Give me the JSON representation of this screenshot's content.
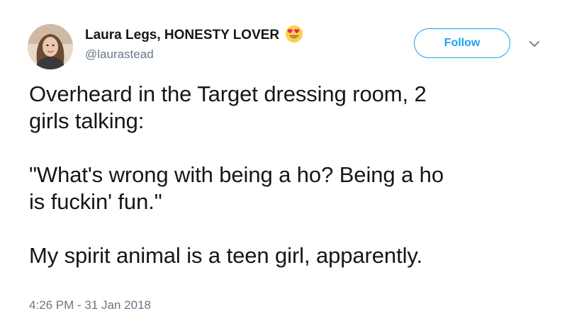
{
  "author": {
    "display_name": "Laura Legs, HONESTY LOVER",
    "handle": "@laurastead",
    "name_emoji": "heart-eyes-emoji"
  },
  "actions": {
    "follow_label": "Follow",
    "menu_icon": "chevron-down-icon"
  },
  "tweet": {
    "line1": "Overheard in the Target dressing room, 2",
    "line2": "girls talking:",
    "line3": "\"What's wrong with being a ho? Being a ho",
    "line4": "is fuckin' fun.\"",
    "line5": "My spirit animal is a teen girl, apparently.",
    "timestamp": "4:26 PM - 31 Jan 2018"
  },
  "colors": {
    "accent": "#1da1f2",
    "text": "#14171a",
    "secondary": "#657786"
  }
}
